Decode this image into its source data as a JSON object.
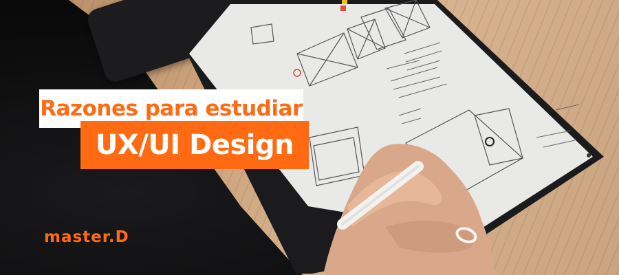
{
  "banner": {
    "title_line1": "Razones para estudiar",
    "title_line2": "UX/UI Design",
    "brand_logo": "master.D"
  },
  "colors": {
    "accent": "#ff6a13",
    "title_bg": "#ffffff"
  },
  "photo": {
    "icons": [
      "tablet-icon",
      "stylus-icon"
    ]
  }
}
